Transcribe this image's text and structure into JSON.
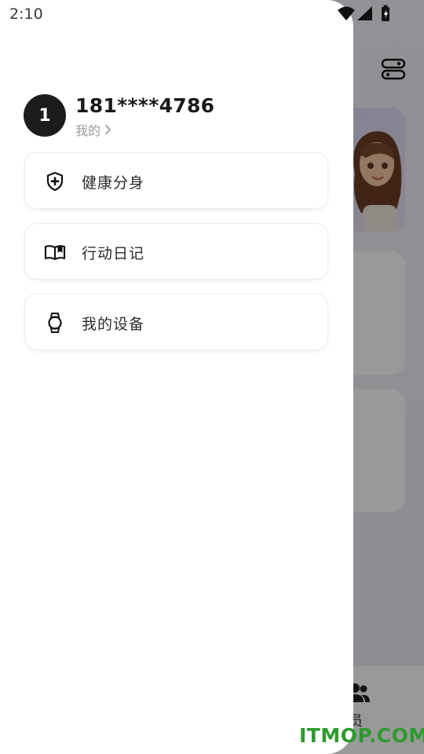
{
  "status_bar": {
    "time": "2:10",
    "icons": [
      "wifi-icon",
      "cell-signal-icon",
      "battery-charging-icon"
    ]
  },
  "profile": {
    "avatar_text": "1",
    "phone": "181****4786",
    "link_label": "我的"
  },
  "menu": {
    "items": [
      {
        "label": "健康分身",
        "icon": "shield-plus-icon"
      },
      {
        "label": "行动日记",
        "icon": "open-book-icon"
      },
      {
        "label": "我的设备",
        "icon": "smartwatch-icon"
      }
    ]
  },
  "background": {
    "bottom_nav": {
      "members_label": "员"
    }
  },
  "watermark": "ITMOP.COM",
  "colors": {
    "scrim": "rgba(0,0,0,0.40)",
    "drawer": "#ffffff",
    "avatar_bg": "#1c1c1c",
    "watermark": "#2e9a2e",
    "hero_card": "#dcd6f3"
  }
}
